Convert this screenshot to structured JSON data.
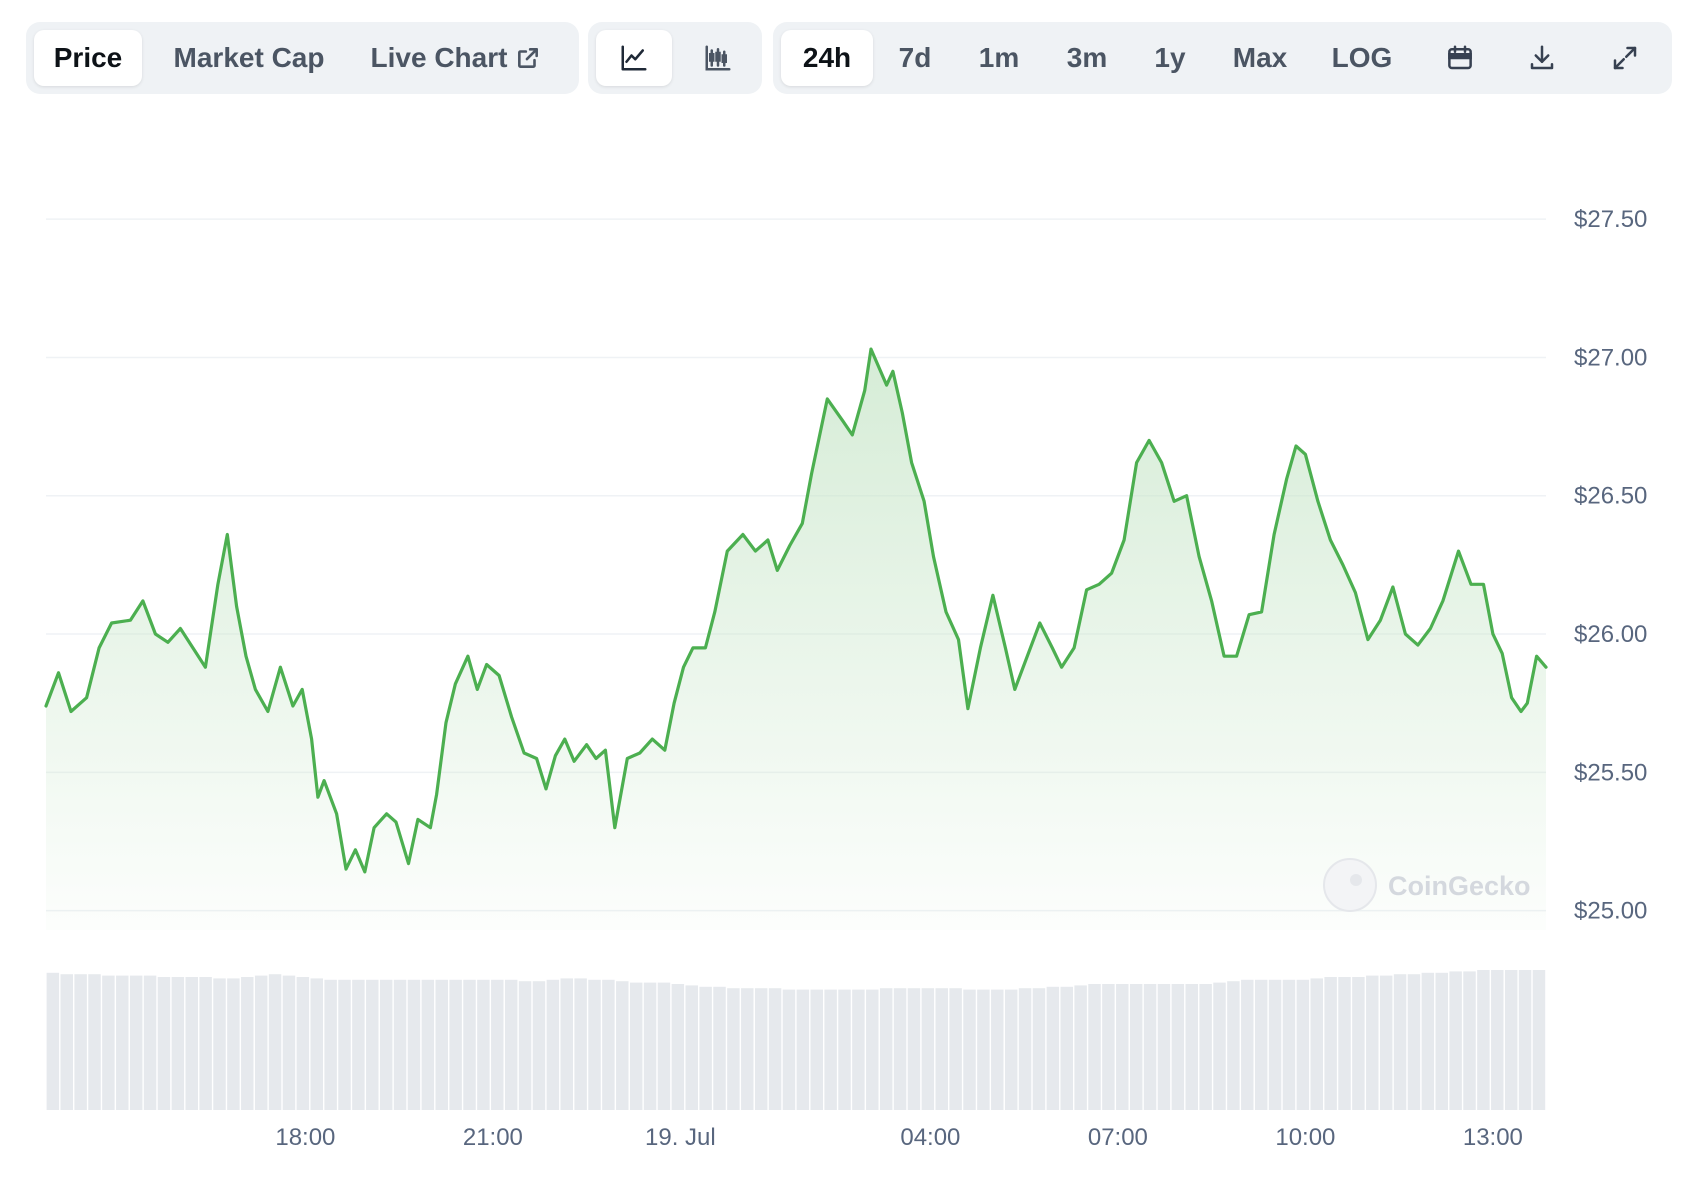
{
  "toolbar": {
    "view_tabs": [
      "Price",
      "Market Cap",
      "Live Chart"
    ],
    "active_view": "Price",
    "chart_types": [
      "line-chart-icon",
      "candlestick-icon"
    ],
    "active_chart_type": "line-chart-icon",
    "ranges": [
      "24h",
      "7d",
      "1m",
      "3m",
      "1y",
      "Max",
      "LOG"
    ],
    "active_range": "24h",
    "tools": [
      "calendar-icon",
      "download-icon",
      "fullscreen-icon"
    ]
  },
  "colors": {
    "line": "#4caf50",
    "area_top": "#c8e6c9",
    "volume": "#e6e9ed",
    "grid": "#eff2f5",
    "axis_text": "#58667e"
  },
  "watermark": "CoinGecko",
  "chart_data": {
    "type": "area",
    "xlabel": "",
    "ylabel": "",
    "ylim": [
      24.93,
      27.75
    ],
    "y_ticks": [
      "$25.00",
      "$25.50",
      "$26.00",
      "$26.50",
      "$27.00",
      "$27.50"
    ],
    "y_tick_values": [
      25.0,
      25.5,
      26.0,
      26.5,
      27.0,
      27.5
    ],
    "x_tick_labels": [
      "18:00",
      "21:00",
      "19. Jul",
      "04:00",
      "07:00",
      "10:00",
      "13:00"
    ],
    "x_tick_hours": [
      3.0,
      6.0,
      9.0,
      13.0,
      16.0,
      19.0,
      22.0
    ],
    "x_range_hours": [
      -1.15,
      22.85
    ],
    "grid": true,
    "legend": "none",
    "series": [
      {
        "points": [
          [
            -1.15,
            25.74
          ],
          [
            -0.95,
            25.86
          ],
          [
            -0.75,
            25.72
          ],
          [
            -0.5,
            25.77
          ],
          [
            -0.3,
            25.95
          ],
          [
            -0.1,
            26.04
          ],
          [
            0.2,
            26.05
          ],
          [
            0.4,
            26.12
          ],
          [
            0.6,
            26.0
          ],
          [
            0.8,
            25.97
          ],
          [
            1.0,
            26.02
          ],
          [
            1.2,
            25.95
          ],
          [
            1.4,
            25.88
          ],
          [
            1.6,
            26.18
          ],
          [
            1.75,
            26.36
          ],
          [
            1.9,
            26.1
          ],
          [
            2.05,
            25.92
          ],
          [
            2.2,
            25.8
          ],
          [
            2.4,
            25.72
          ],
          [
            2.6,
            25.88
          ],
          [
            2.8,
            25.74
          ],
          [
            2.95,
            25.8
          ],
          [
            3.1,
            25.62
          ],
          [
            3.2,
            25.41
          ],
          [
            3.3,
            25.47
          ],
          [
            3.5,
            25.35
          ],
          [
            3.65,
            25.15
          ],
          [
            3.8,
            25.22
          ],
          [
            3.95,
            25.14
          ],
          [
            4.1,
            25.3
          ],
          [
            4.3,
            25.35
          ],
          [
            4.45,
            25.32
          ],
          [
            4.65,
            25.17
          ],
          [
            4.8,
            25.33
          ],
          [
            5.0,
            25.3
          ],
          [
            5.1,
            25.42
          ],
          [
            5.25,
            25.68
          ],
          [
            5.4,
            25.82
          ],
          [
            5.6,
            25.92
          ],
          [
            5.75,
            25.8
          ],
          [
            5.9,
            25.89
          ],
          [
            6.1,
            25.85
          ],
          [
            6.3,
            25.7
          ],
          [
            6.5,
            25.57
          ],
          [
            6.7,
            25.55
          ],
          [
            6.85,
            25.44
          ],
          [
            7.0,
            25.56
          ],
          [
            7.15,
            25.62
          ],
          [
            7.3,
            25.54
          ],
          [
            7.5,
            25.6
          ],
          [
            7.65,
            25.55
          ],
          [
            7.8,
            25.58
          ],
          [
            7.95,
            25.3
          ],
          [
            8.15,
            25.55
          ],
          [
            8.35,
            25.57
          ],
          [
            8.55,
            25.62
          ],
          [
            8.75,
            25.58
          ],
          [
            8.9,
            25.75
          ],
          [
            9.05,
            25.88
          ],
          [
            9.2,
            25.95
          ],
          [
            9.4,
            25.95
          ],
          [
            9.55,
            26.08
          ],
          [
            9.75,
            26.3
          ],
          [
            10.0,
            26.36
          ],
          [
            10.2,
            26.3
          ],
          [
            10.4,
            26.34
          ],
          [
            10.55,
            26.23
          ],
          [
            10.75,
            26.32
          ],
          [
            10.95,
            26.4
          ],
          [
            11.1,
            26.58
          ],
          [
            11.35,
            26.85
          ],
          [
            11.6,
            26.77
          ],
          [
            11.75,
            26.72
          ],
          [
            11.95,
            26.88
          ],
          [
            12.05,
            27.03
          ],
          [
            12.3,
            26.9
          ],
          [
            12.4,
            26.95
          ],
          [
            12.55,
            26.8
          ],
          [
            12.7,
            26.62
          ],
          [
            12.9,
            26.48
          ],
          [
            13.05,
            26.28
          ],
          [
            13.25,
            26.08
          ],
          [
            13.45,
            25.98
          ],
          [
            13.6,
            25.73
          ],
          [
            13.8,
            25.95
          ],
          [
            14.0,
            26.14
          ],
          [
            14.2,
            25.95
          ],
          [
            14.35,
            25.8
          ],
          [
            14.55,
            25.92
          ],
          [
            14.75,
            26.04
          ],
          [
            14.95,
            25.95
          ],
          [
            15.1,
            25.88
          ],
          [
            15.3,
            25.95
          ],
          [
            15.5,
            26.16
          ],
          [
            15.7,
            26.18
          ],
          [
            15.9,
            26.22
          ],
          [
            16.1,
            26.34
          ],
          [
            16.3,
            26.62
          ],
          [
            16.5,
            26.7
          ],
          [
            16.7,
            26.62
          ],
          [
            16.9,
            26.48
          ],
          [
            17.1,
            26.5
          ],
          [
            17.3,
            26.28
          ],
          [
            17.5,
            26.12
          ],
          [
            17.7,
            25.92
          ],
          [
            17.9,
            25.92
          ],
          [
            18.1,
            26.07
          ],
          [
            18.3,
            26.08
          ],
          [
            18.5,
            26.36
          ],
          [
            18.7,
            26.56
          ],
          [
            18.85,
            26.68
          ],
          [
            19.0,
            26.65
          ],
          [
            19.2,
            26.48
          ],
          [
            19.4,
            26.34
          ],
          [
            19.6,
            26.25
          ],
          [
            19.8,
            26.15
          ],
          [
            20.0,
            25.98
          ],
          [
            20.2,
            26.05
          ],
          [
            20.4,
            26.17
          ],
          [
            20.6,
            26.0
          ],
          [
            20.8,
            25.96
          ],
          [
            21.0,
            26.02
          ],
          [
            21.2,
            26.12
          ],
          [
            21.45,
            26.3
          ],
          [
            21.65,
            26.18
          ],
          [
            21.85,
            26.18
          ],
          [
            22.0,
            26.0
          ],
          [
            22.15,
            25.93
          ],
          [
            22.3,
            25.77
          ],
          [
            22.45,
            25.72
          ],
          [
            22.55,
            25.75
          ],
          [
            22.7,
            25.92
          ],
          [
            22.85,
            25.88
          ]
        ]
      }
    ],
    "volume_relative": [
      0.98,
      0.97,
      0.97,
      0.97,
      0.96,
      0.96,
      0.96,
      0.96,
      0.95,
      0.95,
      0.95,
      0.95,
      0.94,
      0.94,
      0.95,
      0.96,
      0.97,
      0.96,
      0.95,
      0.94,
      0.93,
      0.93,
      0.93,
      0.93,
      0.93,
      0.93,
      0.93,
      0.93,
      0.93,
      0.93,
      0.93,
      0.93,
      0.93,
      0.93,
      0.92,
      0.92,
      0.93,
      0.94,
      0.94,
      0.93,
      0.93,
      0.92,
      0.91,
      0.91,
      0.91,
      0.9,
      0.89,
      0.88,
      0.88,
      0.87,
      0.87,
      0.87,
      0.87,
      0.86,
      0.86,
      0.86,
      0.86,
      0.86,
      0.86,
      0.86,
      0.87,
      0.87,
      0.87,
      0.87,
      0.87,
      0.87,
      0.86,
      0.86,
      0.86,
      0.86,
      0.87,
      0.87,
      0.88,
      0.88,
      0.89,
      0.9,
      0.9,
      0.9,
      0.9,
      0.9,
      0.9,
      0.9,
      0.9,
      0.9,
      0.91,
      0.92,
      0.93,
      0.93,
      0.93,
      0.93,
      0.93,
      0.94,
      0.95,
      0.95,
      0.95,
      0.96,
      0.96,
      0.97,
      0.97,
      0.98,
      0.98,
      0.99,
      0.99,
      1.0,
      1.0,
      1.0,
      1.0,
      1.0
    ]
  }
}
